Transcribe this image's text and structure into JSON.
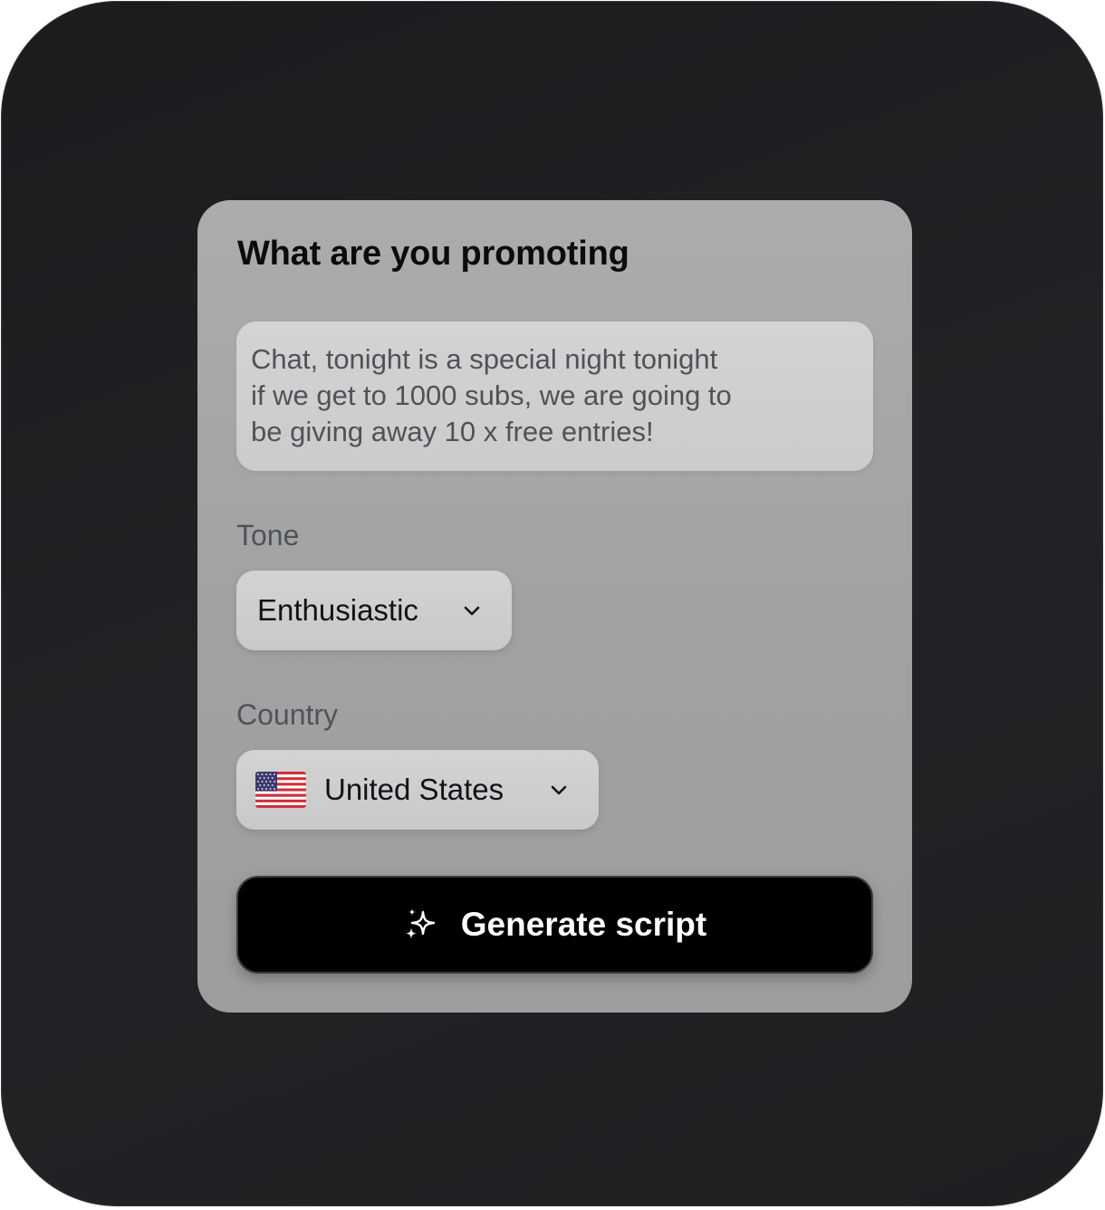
{
  "form": {
    "heading": "What are you promoting",
    "promotion_text": "Chat, tonight is a special night tonight\nif we get to 1000 subs, we are going to\nbe giving away 10 x free entries!",
    "tone": {
      "label": "Tone",
      "selected": "Enthusiastic",
      "icon": "chevron-down-icon"
    },
    "country": {
      "label": "Country",
      "selected": "United States",
      "flag_icon": "us-flag-icon",
      "icon": "chevron-down-icon"
    },
    "generate_button": {
      "label": "Generate script",
      "icon": "sparkles-icon"
    }
  },
  "colors": {
    "background": "#1f2022",
    "card": "#a4a4a4",
    "field": "#cfcfcf",
    "button": "#000000",
    "button_text": "#ffffff"
  }
}
